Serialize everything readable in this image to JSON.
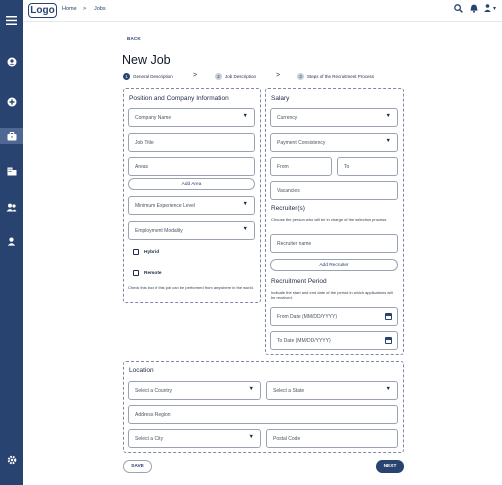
{
  "header": {
    "logo": "Logo",
    "breadcrumb": {
      "home": "Home",
      "separator": ">",
      "current": "Jobs"
    },
    "search_icon": "search-icon",
    "bell_icon": "bell-icon",
    "user_icon": "user-icon",
    "caret": "▾"
  },
  "sidebar": {
    "menu_icon": "menu-icon",
    "items": [
      {
        "icon": "user-circle-icon"
      },
      {
        "icon": "plus-circle-icon"
      },
      {
        "icon": "briefcase-icon",
        "active": true
      },
      {
        "icon": "building-icon"
      },
      {
        "icon": "users-icon"
      },
      {
        "icon": "person-icon"
      }
    ],
    "settings_icon": "gear-icon"
  },
  "page": {
    "back": "BACK",
    "title": "New Job",
    "steps": [
      {
        "num": "1",
        "label": "General Description",
        "active": true
      },
      {
        "num": "2",
        "label": "Job Description",
        "active": false
      },
      {
        "num": "3",
        "label": "Steps of the Recruitment Process",
        "active": false
      }
    ],
    "step_arrow": ">"
  },
  "position": {
    "title": "Position and Company Information",
    "company_name": "Company Name",
    "job_title": "Job Title",
    "areas": "Areas",
    "add_area": "Add Area",
    "min_experience": "Minimum Experience Level",
    "modality": "Employment Modality",
    "hybrid": "Hybrid",
    "remote": "Remote",
    "hint": "Check this box if this job can be performed from anywhere in the world."
  },
  "salary": {
    "title": "Salary",
    "currency": "Currency",
    "consistency": "Payment Consistency",
    "from": "From",
    "to": "To",
    "vacancies": "Vacancies"
  },
  "recruiters": {
    "title": "Recruiter(s)",
    "hint": "Choose the person who will be in charge of the selection process.",
    "name": "Recruiter name",
    "add": "Add Recruiter"
  },
  "period": {
    "title": "Recruitment Period",
    "hint": "Indicate the start and end date of the period in which applications will be received.",
    "from_date": "From Date (MM/DD/YYYY)",
    "to_date": "To Date (MM/DD/YYYY)"
  },
  "location": {
    "title": "Location",
    "country": "Select a Country",
    "state": "Select a State",
    "address": "Address Region",
    "city": "Select a City",
    "postal": "Postal Code"
  },
  "actions": {
    "save": "SAVE",
    "next": "NEXT"
  }
}
